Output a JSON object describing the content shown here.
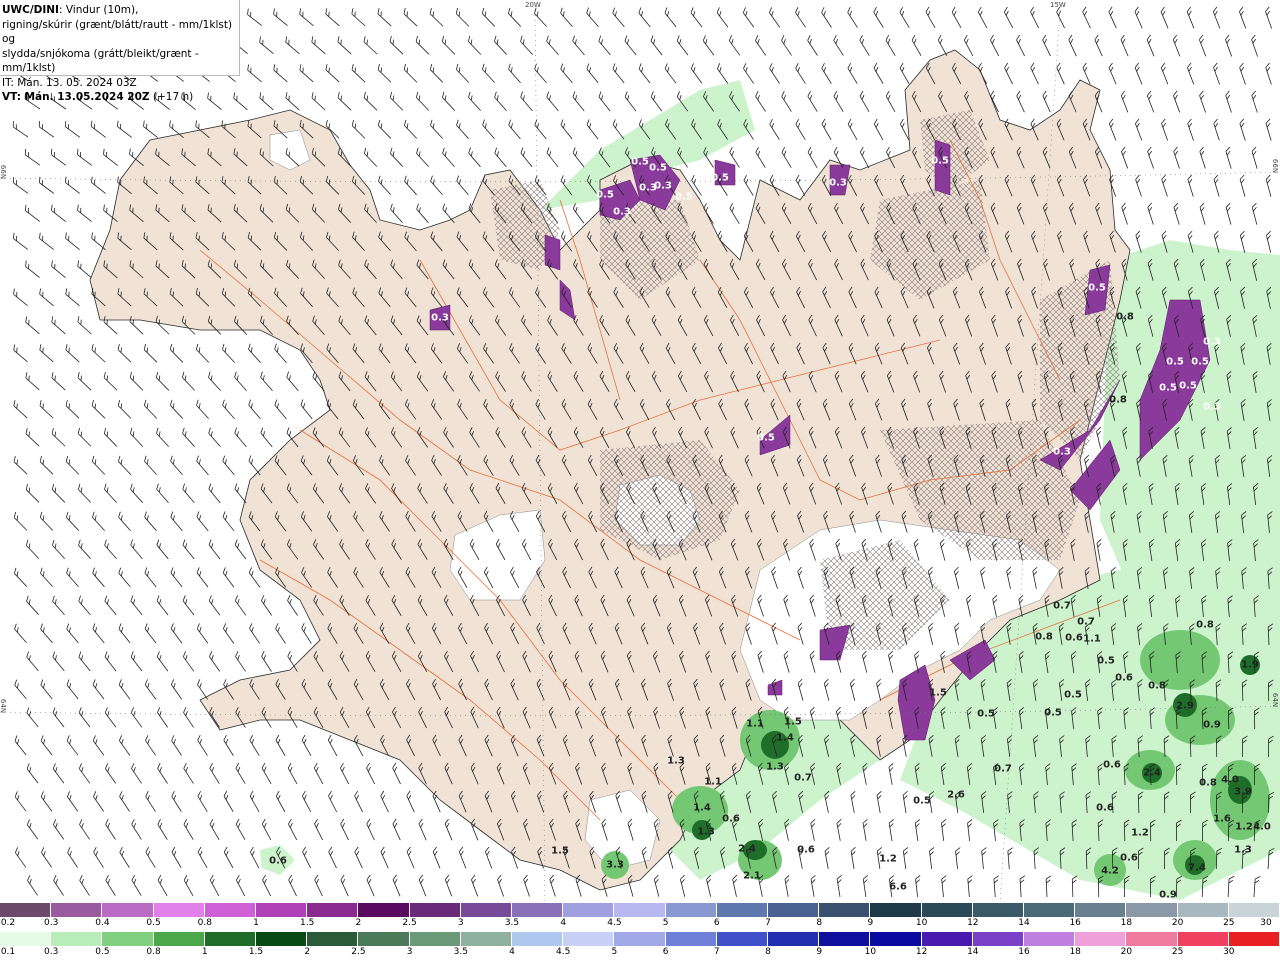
{
  "header": {
    "model": "UWC/DINI",
    "line1_rest": ": Vindur (10m),",
    "line2": "rigning/skúrir (grænt/blátt/rautt - mm/1klst) og",
    "line3": "slydda/snjókoma (grátt/bleikt/grænt - mm/1klst)",
    "it_line": "IT: Mán. 13. 05. 2024 03Z",
    "vt_label": "VT: Mán. 13.05.2024 20Z",
    "vt_offset": " (+17 h)"
  },
  "graticule": {
    "lon_labels": [
      "20W",
      "15W"
    ],
    "lat_labels": [
      "66N",
      "64N"
    ]
  },
  "colors": {
    "land": "#f0e3d6",
    "ice": "#ffffff",
    "sea": "#ffffff",
    "roads": "#e8703a",
    "rain_light": "#c8f2c8",
    "rain_mid": "#6fc46f",
    "rain_heavy": "#1e6e2a",
    "snow_purple": "#8a3a9a",
    "snow_light": "#b070c8"
  },
  "precip_labels": [
    {
      "t": "0.3"
    },
    {
      "t": "0.5"
    },
    {
      "t": "0.5"
    },
    {
      "t": "0.3"
    },
    {
      "t": "0.5"
    },
    {
      "t": "0.3"
    },
    {
      "t": "0.3"
    },
    {
      "t": "0.5"
    },
    {
      "t": "0.5"
    },
    {
      "t": "0.3"
    },
    {
      "t": "0.5"
    },
    {
      "t": "0.8"
    },
    {
      "t": "0.5"
    },
    {
      "t": "0.3"
    },
    {
      "t": "0.5"
    },
    {
      "t": "0.5"
    },
    {
      "t": "0.5"
    },
    {
      "t": "0.5"
    },
    {
      "t": "0.3"
    },
    {
      "t": "0.8"
    },
    {
      "t": "0.3"
    },
    {
      "t": "0.5"
    },
    {
      "t": "0.7"
    },
    {
      "t": "0.7"
    },
    {
      "t": "0.8"
    },
    {
      "t": "0.6"
    },
    {
      "t": "1.1"
    },
    {
      "t": "0.8"
    },
    {
      "t": "0.5"
    },
    {
      "t": "1.9"
    },
    {
      "t": "0.6"
    },
    {
      "t": "0.8"
    },
    {
      "t": "0.5"
    },
    {
      "t": "2.9"
    },
    {
      "t": "0.9"
    },
    {
      "t": "0.5"
    },
    {
      "t": "0.5"
    },
    {
      "t": "1.1"
    },
    {
      "t": "1.5"
    },
    {
      "t": "1.4"
    },
    {
      "t": "1.3"
    },
    {
      "t": "0.7"
    },
    {
      "t": "1.3"
    },
    {
      "t": "1.1"
    },
    {
      "t": "1.4"
    },
    {
      "t": "0.6"
    },
    {
      "t": "1.3"
    },
    {
      "t": "2.4"
    },
    {
      "t": "0.6"
    },
    {
      "t": "2.1"
    },
    {
      "t": "1.5"
    },
    {
      "t": "3.3"
    },
    {
      "t": "0.6"
    },
    {
      "t": "0.5"
    },
    {
      "t": "2.6"
    },
    {
      "t": "0.7"
    },
    {
      "t": "0.6"
    },
    {
      "t": "2.4"
    },
    {
      "t": "0.8"
    },
    {
      "t": "4.0"
    },
    {
      "t": "3.9"
    },
    {
      "t": "1.6"
    },
    {
      "t": "1.2"
    },
    {
      "t": "4.0"
    },
    {
      "t": "1.2"
    },
    {
      "t": "0.6"
    },
    {
      "t": "1.3"
    },
    {
      "t": "1.2"
    },
    {
      "t": "6.6"
    },
    {
      "t": "4.2"
    },
    {
      "t": "7.4"
    },
    {
      "t": "0.9"
    },
    {
      "t": "0.6"
    },
    {
      "t": "1.5"
    }
  ],
  "legend_top": {
    "labels": [
      "0.2",
      "0.3",
      "0.4",
      "0.5",
      "0.8",
      "1",
      "1.5",
      "2",
      "2.5",
      "3",
      "3.5",
      "4",
      "4.5",
      "5",
      "6",
      "7",
      "8",
      "9",
      "10",
      "12",
      "14",
      "16",
      "18",
      "20",
      "25",
      "30"
    ],
    "colors": [
      "#6b4a6b",
      "#9a5aa0",
      "#b86cc4",
      "#e080e8",
      "#d060d8",
      "#b040b8",
      "#8a2a90",
      "#5a0a5e",
      "#6a2a7a",
      "#7a4a9a",
      "#8a70b8",
      "#a0a0e0",
      "#b8b8f0",
      "#8898d0",
      "#6078b0",
      "#4a6090",
      "#3a5070",
      "#1e3a4a",
      "#2a4a5a",
      "#3a5a6a",
      "#4a6a7a",
      "#6a8090",
      "#8a98a8",
      "#a8b8c0",
      "#c8d4d8"
    ]
  },
  "legend_bottom": {
    "labels": [
      "0.1",
      "0.3",
      "0.5",
      "0.8",
      "1",
      "1.5",
      "2",
      "2.5",
      "3",
      "3.5",
      "4",
      "4.5",
      "5",
      "6",
      "7",
      "8",
      "9",
      "10",
      "12",
      "14",
      "16",
      "18",
      "20",
      "25",
      "30"
    ],
    "colors": [
      "#e6fae6",
      "#b8ecb8",
      "#80d080",
      "#4aa84a",
      "#1e6e2a",
      "#0a4a14",
      "#2a5a3a",
      "#4a7a5a",
      "#6a9a7a",
      "#90b0a0",
      "#b0c8f0",
      "#c8d0f8",
      "#a0a8e8",
      "#7080d8",
      "#4050c8",
      "#2030b0",
      "#1010a0",
      "#0a0aa0",
      "#4a1ab0",
      "#7a40c8",
      "#c080e0",
      "#f0a0d8",
      "#f07aa0",
      "#f04060",
      "#e82020"
    ]
  }
}
